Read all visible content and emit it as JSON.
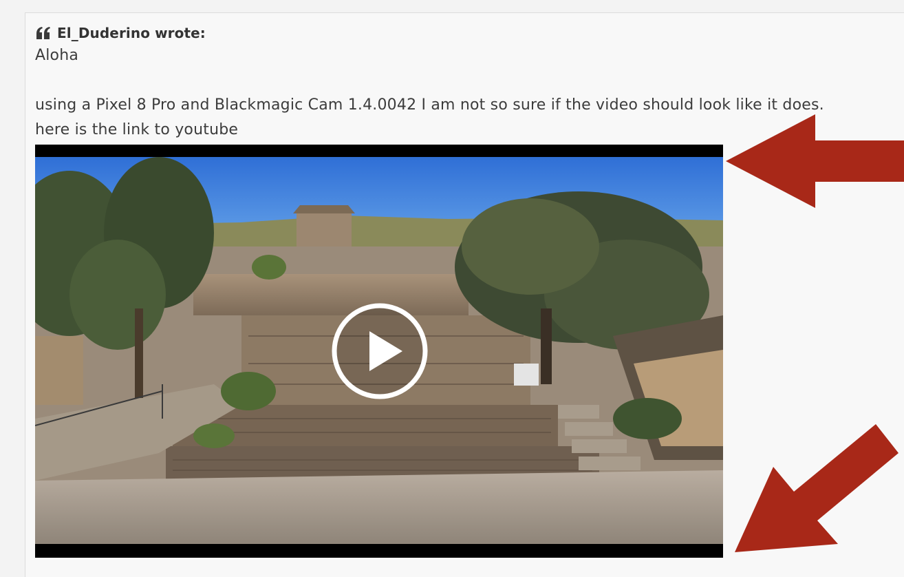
{
  "quote": {
    "author_line": "El_Duderino wrote:",
    "icon": "quote-left-icon",
    "lines": [
      "Aloha",
      "using a Pixel 8 Pro and Blackmagic Cam 1.4.0042 I am not so sure if the video should look like it does.",
      "here is the link to youtube"
    ]
  },
  "video": {
    "icon": "play-icon"
  },
  "annotations": {
    "arrow_color": "#a82818",
    "arrows": [
      "arrow-left-icon",
      "arrow-down-left-icon"
    ]
  },
  "colors": {
    "text": "#3c3c3c",
    "author": "#333333",
    "box_background": "#f8f8f8",
    "page_background": "#f3f3f3",
    "letterbox": "#000000"
  }
}
